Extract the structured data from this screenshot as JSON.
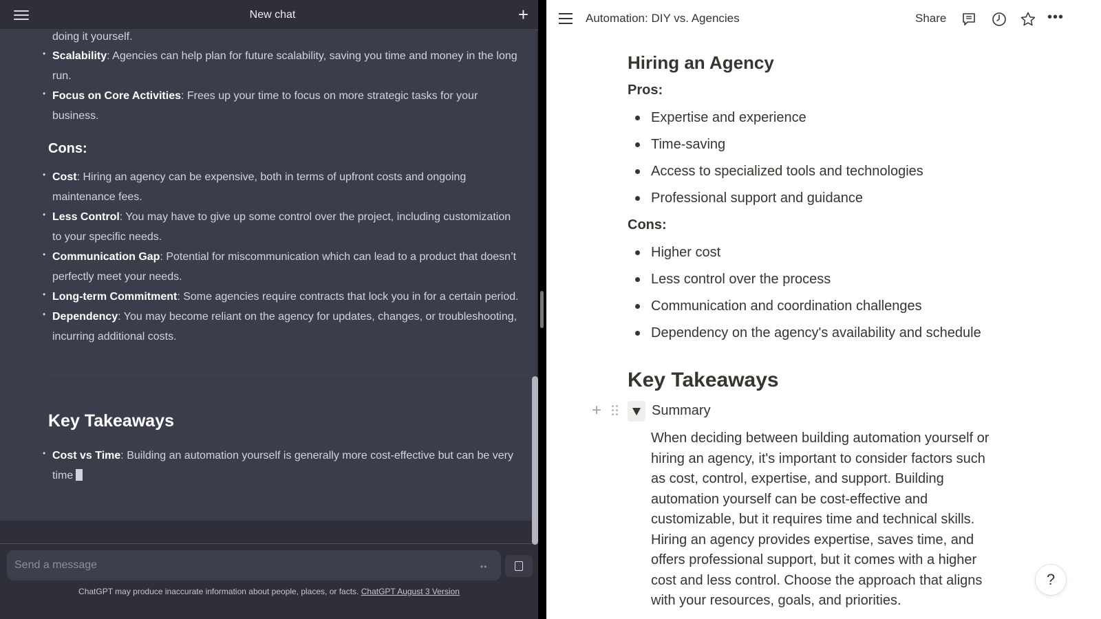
{
  "chatgpt": {
    "header": {
      "title": "New chat",
      "menu_icon": "hamburger-menu-icon",
      "new_chat_icon": "plus-icon"
    },
    "message": {
      "top_partial_line": "doing it yourself.",
      "pros_tail": [
        {
          "term": "Scalability",
          "text": ": Agencies can help plan for future scalability, saving you time and money in the long",
          "cont": "run."
        },
        {
          "term": "Focus on Core Activities",
          "text": ": Frees up your time to focus on more strategic tasks for your",
          "cont": "business."
        }
      ],
      "cons_heading": "Cons:",
      "cons": [
        {
          "term": "Cost",
          "text": ": Hiring an agency can be expensive, both in terms of upfront costs and ongoing",
          "cont": "maintenance fees."
        },
        {
          "term": "Less Control",
          "text": ": You may have to give up some control over the project, including customization",
          "cont": "to your specific needs."
        },
        {
          "term": "Communication Gap",
          "text": ": Potential for miscommunication which can lead to a product that doesn’t",
          "cont": "perfectly meet your needs."
        },
        {
          "term": "Long-term Commitment",
          "text": ": Some agencies require contracts that lock you in for a certain period.",
          "cont": ""
        },
        {
          "term": "Dependency",
          "text": ": You may become reliant on the agency for updates, changes, or troubleshooting,",
          "cont": "incurring additional costs."
        }
      ],
      "takeaways_heading": "Key Takeaways",
      "takeaways": [
        {
          "term": "Cost vs Time",
          "text": ": Building an automation yourself is generally more cost-effective but can be very",
          "cont": "time"
        }
      ]
    },
    "composer": {
      "placeholder": "Send a message",
      "value": "",
      "stop_icon": "stop-square-icon"
    },
    "disclaimer": {
      "text": "ChatGPT may produce inaccurate information about people, places, or facts.",
      "link": "ChatGPT August 3 Version"
    }
  },
  "notion": {
    "header": {
      "title": "Automation: DIY vs. Agencies",
      "share_label": "Share",
      "icons": [
        "comment-icon",
        "history-icon",
        "star-icon",
        "more-icon"
      ]
    },
    "section_heading": "Hiring an Agency",
    "pros_label": "Pros:",
    "pros": [
      "Expertise and experience",
      "Time-saving",
      "Access to specialized tools and technologies",
      "Professional support and guidance"
    ],
    "cons_label": "Cons:",
    "cons": [
      "Higher cost",
      "Less control over the process",
      "Communication and coordination challenges",
      "Dependency on the agency's availability and schedule"
    ],
    "takeaways_heading": "Key Takeaways",
    "toggle": {
      "label": "Summary",
      "expanded": true,
      "body": "When deciding between building automation yourself or hiring an agency, it's important to consider factors such as cost, control, expertise, and support. Building automation yourself can be cost-effective and customizable, but it requires time and technical skills. Hiring an agency provides expertise, saves time, and offers professional support, but it comes with a higher cost and less control. Choose the approach that aligns with your resources, goals, and priorities."
    },
    "help_label": "?"
  }
}
